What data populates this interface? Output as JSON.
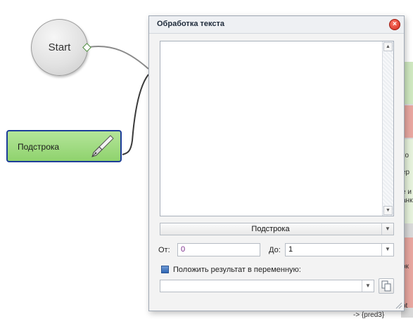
{
  "canvas": {
    "start_node_label": "Start",
    "action_node_label": "Подстрока",
    "bg_fragments": [
      "ко",
      "ер",
      "е и",
      "анк",
      "ок",
      "ot",
      "-> {pred3}"
    ]
  },
  "dialog": {
    "title": "Обработка текста",
    "text_value": "",
    "operation": "Подстрока",
    "from_label": "От:",
    "from_value": "0",
    "to_label": "До:",
    "to_value": "1",
    "save_to_var_label": "Положить результат в переменную:",
    "save_to_var_checked": true,
    "variable_value": ""
  },
  "colors": {
    "action_node_fill": "#8fd26d",
    "action_node_border": "#1d3d9a",
    "close_button": "#d2261a",
    "from_value_text": "#7a2a8a"
  },
  "icons": [
    "pen-nib-icon",
    "close-icon",
    "scroll-up-icon",
    "scroll-down-icon",
    "dropdown-arrow-icon",
    "copy-icon",
    "resize-grip-icon"
  ]
}
